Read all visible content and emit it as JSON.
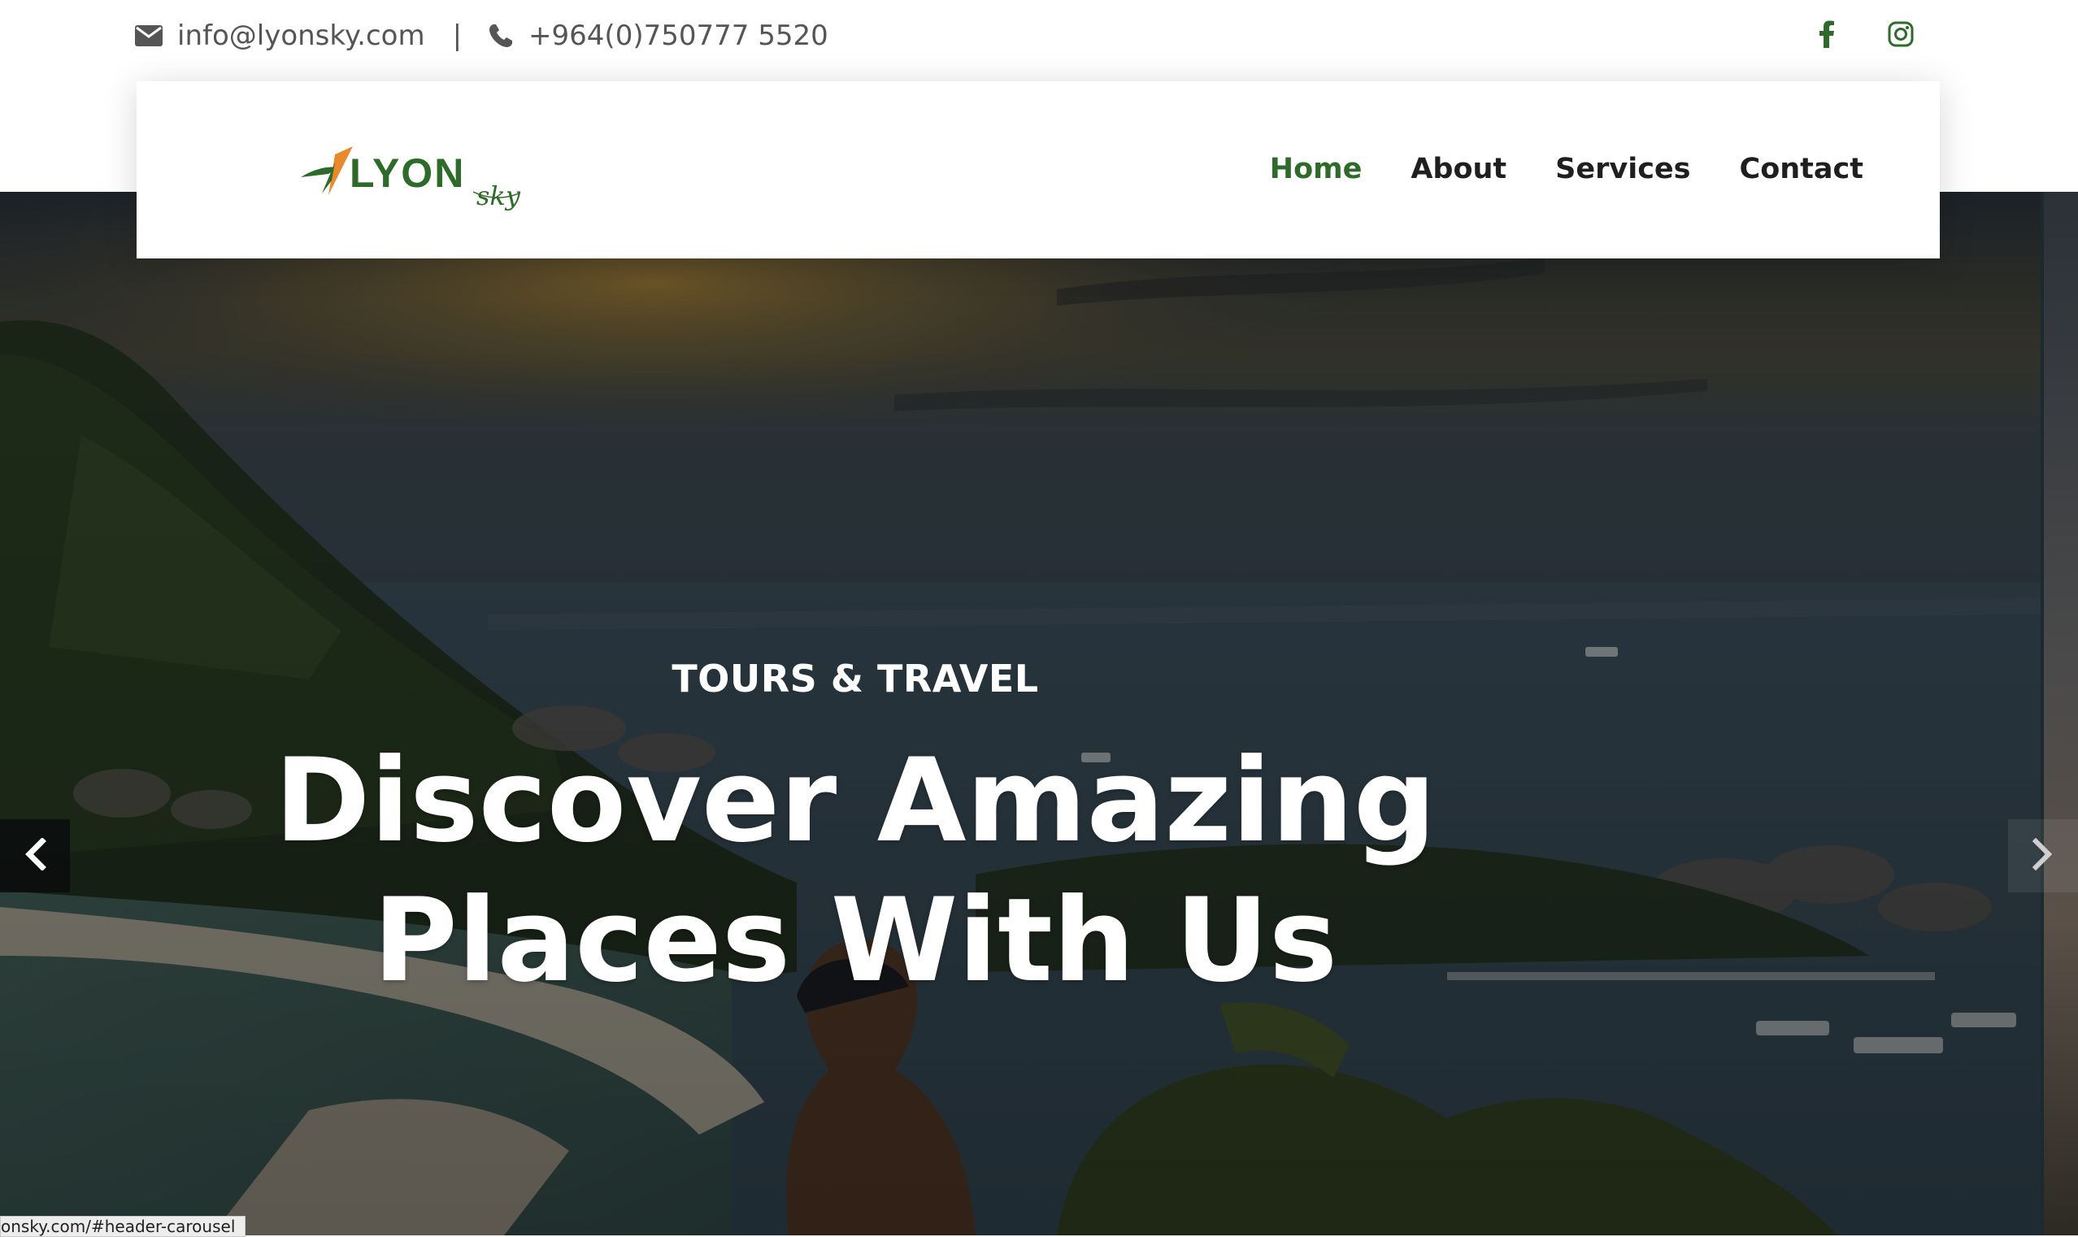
{
  "topbar": {
    "email": "info@lyonsky.com",
    "separator": "|",
    "phone": "+964(0)750777 5520",
    "icons": [
      "envelope-icon",
      "phone-icon",
      "facebook-icon",
      "instagram-icon"
    ]
  },
  "brand": {
    "logo_main": "LYON",
    "logo_script": "sky",
    "colors": {
      "green": "#2e6b2a",
      "orange": "#e8892b"
    }
  },
  "nav": {
    "items": [
      {
        "label": "Home",
        "active": true
      },
      {
        "label": "About",
        "active": false
      },
      {
        "label": "Services",
        "active": false
      },
      {
        "label": "Contact",
        "active": false
      }
    ]
  },
  "hero": {
    "subtitle": "TOURS & TRAVEL",
    "headline_line1": "Discover Amazing",
    "headline_line2": "Places With Us",
    "prev_icon": "chevron-left-icon",
    "next_icon": "chevron-right-icon"
  },
  "status_bar": {
    "url": "onsky.com/#header-carousel"
  }
}
